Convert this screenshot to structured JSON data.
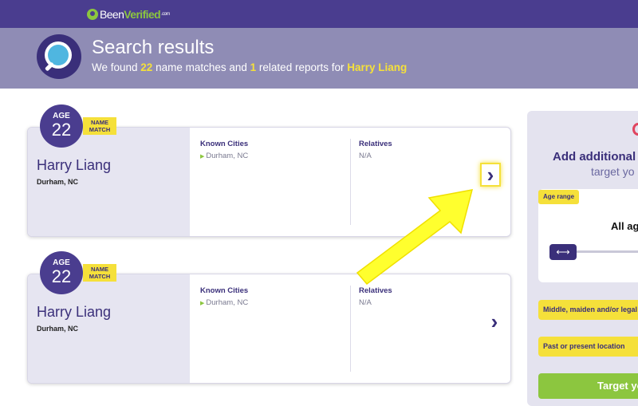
{
  "header": {
    "logo_text_1": "Been",
    "logo_text_2": "Verified",
    "logo_mark": ".com"
  },
  "banner": {
    "title": "Search results",
    "sub_prefix": "We found ",
    "name_matches": "22",
    "sub_middle": " name matches and ",
    "related_reports": "1",
    "sub_middle2": " related reports for ",
    "query_name": "Harry Liang"
  },
  "results": [
    {
      "age_label": "AGE",
      "age": "22",
      "match_tag_line1": "NAME",
      "match_tag_line2": "MATCH",
      "name": "Harry Liang",
      "location": "Durham, NC",
      "known_cities_label": "Known Cities",
      "known_cities": "Durham, NC",
      "relatives_label": "Relatives",
      "relatives": "N/A"
    },
    {
      "age_label": "AGE",
      "age": "22",
      "match_tag_line1": "NAME",
      "match_tag_line2": "MATCH",
      "name": "Harry Liang",
      "location": "Durham, NC",
      "known_cities_label": "Known Cities",
      "known_cities": "Durham, NC",
      "relatives_label": "Relatives",
      "relatives": "N/A"
    }
  ],
  "sidebar": {
    "title": "Add additional",
    "subtitle": "target yo",
    "age_range_tag": "Age range",
    "age_range_value": "All ag",
    "slider_icon": "⟷",
    "middle_name_field": "Middle, maiden and/or legal",
    "location_field": "Past or present location",
    "target_button": "Target yo"
  },
  "icons": {
    "chevron": "›",
    "city_marker": "▶"
  },
  "colors": {
    "header": "#4a3d8f",
    "banner": "#8f8cb5",
    "accent_yellow": "#f5e03a",
    "brand_green": "#8cc63f",
    "card_left": "#e6e5f1"
  }
}
